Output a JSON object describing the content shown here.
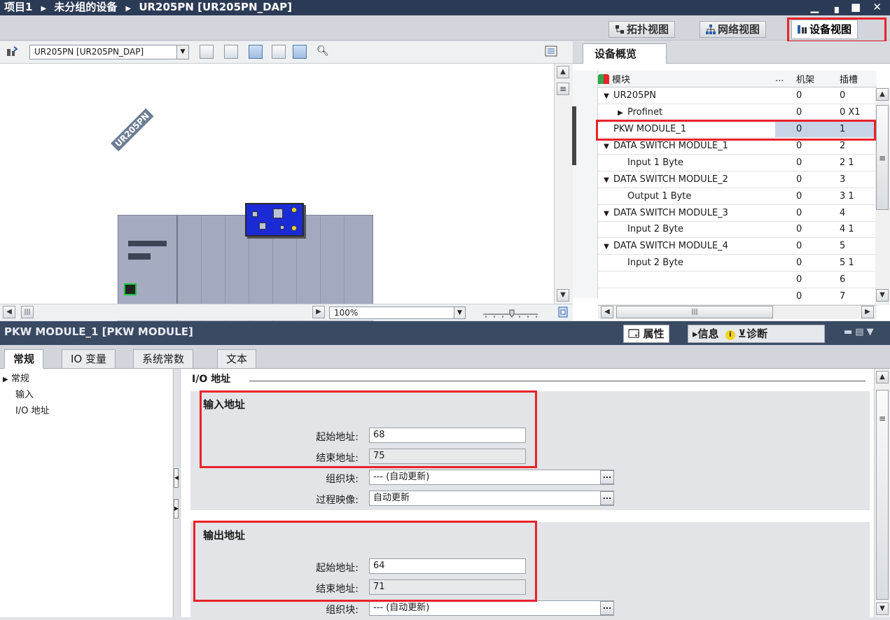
{
  "title_bar": {
    "breadcrumb": [
      "项目1",
      "未分组的设备",
      "UR205PN [UR205PN_DAP]"
    ],
    "controls": "▁ ▗ ■ ✕"
  },
  "view_tabs": {
    "topology": "拓扑视图",
    "network": "网络视图",
    "device": "设备视图"
  },
  "toolbar": {
    "device_select": "UR205PN [UR205PN_DAP]"
  },
  "canvas": {
    "rack_label": "UR205PN",
    "zoom": "100%"
  },
  "overview": {
    "tab": "设备概览",
    "columns": [
      "模块",
      "...",
      "机架",
      "插槽"
    ],
    "rows": [
      {
        "indent": 1,
        "expander": "down",
        "name": "UR205PN",
        "rack": "0",
        "slot": "0"
      },
      {
        "indent": 2,
        "expander": "right",
        "name": "Profinet",
        "rack": "0",
        "slot": "0 X1"
      },
      {
        "indent": 1,
        "expander": "",
        "name": "PKW MODULE_1",
        "rack": "0",
        "slot": "1",
        "selected": true
      },
      {
        "indent": 1,
        "expander": "down",
        "name": "DATA SWITCH MODULE_1",
        "rack": "0",
        "slot": "2"
      },
      {
        "indent": 2,
        "expander": "",
        "name": "Input 1 Byte",
        "rack": "0",
        "slot": "2 1"
      },
      {
        "indent": 1,
        "expander": "down",
        "name": "DATA SWITCH MODULE_2",
        "rack": "0",
        "slot": "3"
      },
      {
        "indent": 2,
        "expander": "",
        "name": "Output 1 Byte",
        "rack": "0",
        "slot": "3 1"
      },
      {
        "indent": 1,
        "expander": "down",
        "name": "DATA SWITCH MODULE_3",
        "rack": "0",
        "slot": "4"
      },
      {
        "indent": 2,
        "expander": "",
        "name": "Input 2 Byte",
        "rack": "0",
        "slot": "4 1"
      },
      {
        "indent": 1,
        "expander": "down",
        "name": "DATA SWITCH MODULE_4",
        "rack": "0",
        "slot": "5"
      },
      {
        "indent": 2,
        "expander": "",
        "name": "Input 2 Byte",
        "rack": "0",
        "slot": "5 1"
      },
      {
        "indent": 0,
        "expander": "",
        "name": "",
        "rack": "0",
        "slot": "6"
      },
      {
        "indent": 0,
        "expander": "",
        "name": "",
        "rack": "0",
        "slot": "7"
      }
    ]
  },
  "properties": {
    "title": "PKW MODULE_1 [PKW MODULE]",
    "tabs": {
      "properties": "属性",
      "info": "信息",
      "diagnostics": "诊断"
    },
    "subtabs": [
      "常规",
      "IO 变量",
      "系统常数",
      "文本"
    ],
    "nav": [
      {
        "label": "常规",
        "expander": "▶"
      },
      {
        "label": "输入",
        "expander": ""
      },
      {
        "label": "I/O 地址",
        "expander": ""
      }
    ],
    "section_title": "I/O 地址",
    "input_group": {
      "title": "输入地址",
      "start_label": "起始地址:",
      "start_value": "68",
      "end_label": "结束地址:",
      "end_value": "75",
      "ob_label": "组织块:",
      "ob_value": "--- (自动更新)",
      "pi_label": "过程映像:",
      "pi_value": "自动更新"
    },
    "output_group": {
      "title": "输出地址",
      "start_label": "起始地址:",
      "start_value": "64",
      "end_label": "结束地址:",
      "end_value": "71",
      "ob_label": "组织块:",
      "ob_value": "--- (自动更新)"
    }
  },
  "colors": {
    "highlight": "#e8232a",
    "title_bar": "#2b3a55",
    "selection": "#c7d3e7"
  }
}
